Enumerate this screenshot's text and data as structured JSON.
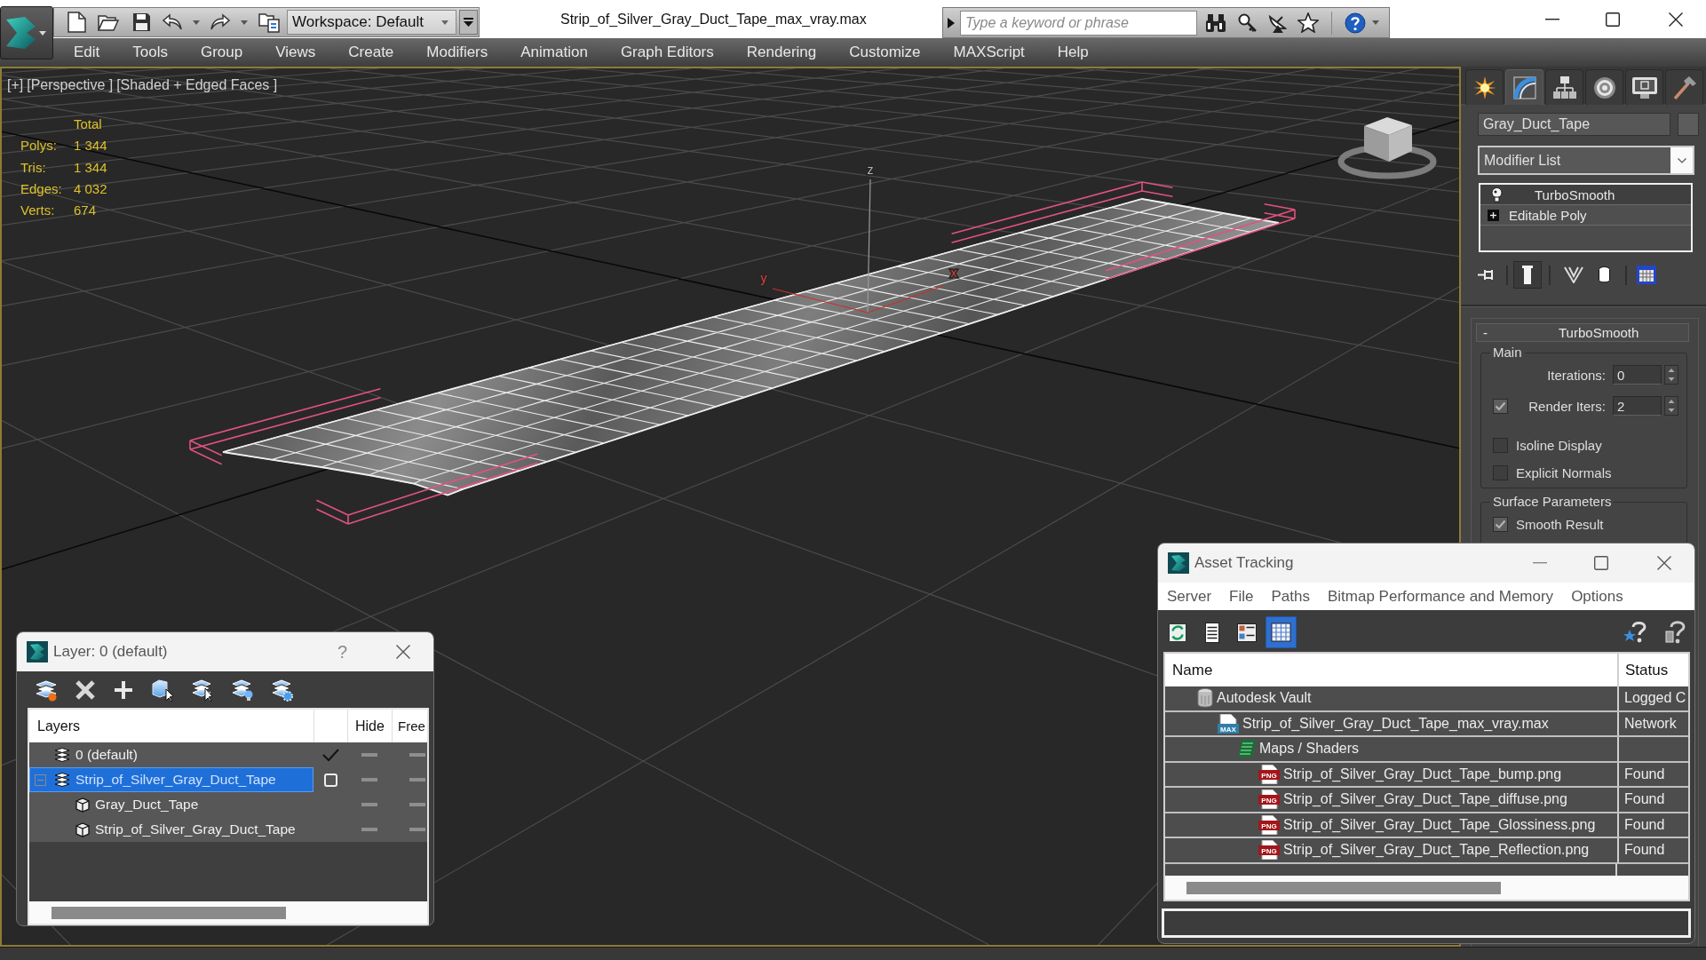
{
  "title_bar": {
    "workspace": "Workspace: Default",
    "title": "Strip_of_Silver_Gray_Duct_Tape_max_vray.max",
    "search": {
      "placeholder": "Type a keyword or phrase"
    }
  },
  "menu": [
    "Edit",
    "Tools",
    "Group",
    "Views",
    "Create",
    "Modifiers",
    "Animation",
    "Graph Editors",
    "Rendering",
    "Customize",
    "MAXScript",
    "Help"
  ],
  "viewport": {
    "labels": [
      "[+]",
      "[Perspective ]",
      "[Shaded + Edged Faces ]"
    ],
    "stats": {
      "header": "Total",
      "rows": [
        {
          "label": "Polys:",
          "value": "1 344"
        },
        {
          "label": "Tris:",
          "value": "1 344"
        },
        {
          "label": "Edges:",
          "value": "4 032"
        },
        {
          "label": "Verts:",
          "value": "674"
        }
      ]
    },
    "axis_labels": [
      "z",
      "y",
      "x"
    ]
  },
  "command_panel": {
    "tabs": [
      {
        "selected": false
      },
      {
        "selected": true
      },
      {
        "selected": false
      },
      {
        "selected": false
      },
      {
        "selected": false
      },
      {
        "selected": false
      }
    ],
    "object_name": "Gray_Duct_Tape",
    "modifier_list": "Modifier List",
    "stack": [
      {
        "kind": "modifier",
        "name": "TurboSmooth",
        "selected": true
      },
      {
        "kind": "base",
        "name": "Editable Poly",
        "selected": false,
        "expanded": false
      }
    ],
    "stack_tools": [
      {
        "on": false
      },
      {
        "on": true
      },
      {
        "on": false
      },
      {
        "on": false
      },
      {
        "on": false
      }
    ],
    "rollout": {
      "toggle": "-",
      "title": "TurboSmooth",
      "groups": [
        {
          "title": "Main",
          "controls": [
            {
              "kind": "spinner",
              "label": "Iterations:",
              "value": "0"
            },
            {
              "kind": "check_spinner",
              "label": "Render Iters:",
              "value": "2",
              "checked": true
            },
            {
              "kind": "checkbox",
              "label": "Isoline Display",
              "checked": false
            },
            {
              "kind": "checkbox",
              "label": "Explicit Normals",
              "checked": false
            }
          ]
        },
        {
          "title": "Surface Parameters",
          "controls": [
            {
              "kind": "checkbox",
              "label": "Smooth Result",
              "checked": true
            }
          ]
        }
      ]
    }
  },
  "layer_dialog": {
    "title": "Layer: 0 (default)",
    "help": "?",
    "columns": [
      "Layers",
      "Hide",
      "Free"
    ],
    "rows": [
      {
        "kind": "layer",
        "name": "0 (default)",
        "selected": false,
        "current": true,
        "hidden": false,
        "frozen": false
      },
      {
        "kind": "layer",
        "name": "Strip_of_Silver_Gray_Duct_Tape",
        "selected": true,
        "current": false,
        "expanded": true,
        "hidden": false,
        "frozen": false,
        "children": [
          {
            "kind": "object",
            "name": "Gray_Duct_Tape",
            "selected": false,
            "hidden": false,
            "frozen": false
          },
          {
            "kind": "object",
            "name": "Strip_of_Silver_Gray_Duct_Tape",
            "selected": false,
            "hidden": false,
            "frozen": false
          }
        ]
      }
    ]
  },
  "asset_tracking": {
    "title": "Asset Tracking",
    "menu": [
      "Server",
      "File",
      "Paths",
      "Bitmap Performance and Memory",
      "Options"
    ],
    "tools": [
      {
        "selected": false
      },
      {
        "selected": false
      },
      {
        "selected": false
      },
      {
        "selected": true
      }
    ],
    "columns": [
      "Name",
      "Status"
    ],
    "rows": [
      {
        "kind": "vault",
        "name": "Autodesk Vault",
        "status": "Logged C",
        "children": [
          {
            "kind": "max",
            "badge": "MAX",
            "name": "Strip_of_Silver_Gray_Duct_Tape_max_vray.max",
            "status": "Network",
            "children": [
              {
                "kind": "folder",
                "name": "Maps / Shaders",
                "children": [
                  {
                    "kind": "png",
                    "badge": "PNG",
                    "name": "Strip_of_Silver_Gray_Duct_Tape_bump.png",
                    "status": "Found"
                  },
                  {
                    "kind": "png",
                    "badge": "PNG",
                    "name": "Strip_of_Silver_Gray_Duct_Tape_diffuse.png",
                    "status": "Found"
                  },
                  {
                    "kind": "png",
                    "badge": "PNG",
                    "name": "Strip_of_Silver_Gray_Duct_Tape_Glossiness.png",
                    "status": "Found"
                  },
                  {
                    "kind": "png",
                    "badge": "PNG",
                    "name": "Strip_of_Silver_Gray_Duct_Tape_Reflection.png",
                    "status": "Found"
                  }
                ]
              }
            ]
          }
        ]
      }
    ]
  }
}
